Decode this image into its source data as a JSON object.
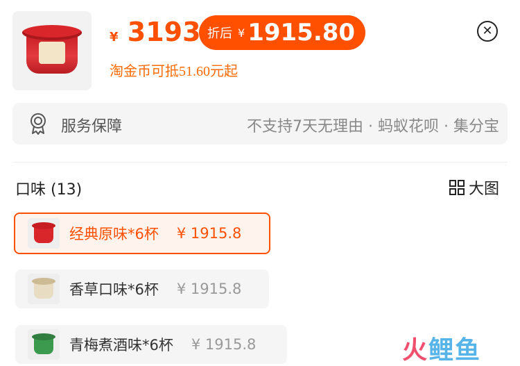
{
  "product": {
    "currency_symbol": "¥",
    "price": "3193",
    "discount_label": "折后",
    "discount_currency": "¥",
    "discount_price": "1915.80",
    "coin_text": "淘金币可抵51.60元起"
  },
  "service": {
    "title": "服务保障",
    "description": "不支持7天无理由 · 蚂蚁花呗 · 集分宝"
  },
  "flavors": {
    "title": "口味 (13)",
    "big_view_label": "大图",
    "options": [
      {
        "name": "经典原味*6杯",
        "price": "¥ 1915.8",
        "selected": true
      },
      {
        "name": "香草口味*6杯",
        "price": "¥ 1915.8",
        "selected": false
      },
      {
        "name": "青梅煮酒味*6杯",
        "price": "¥ 1915.8",
        "selected": false
      }
    ]
  },
  "watermark": {
    "part1": "火",
    "part2": "鲤鱼"
  },
  "colors": {
    "accent": "#ff5000",
    "selected_bg": "#fff3ee",
    "muted": "#999999"
  },
  "icons": [
    "close-icon",
    "award-badge-icon",
    "grid-icon"
  ]
}
